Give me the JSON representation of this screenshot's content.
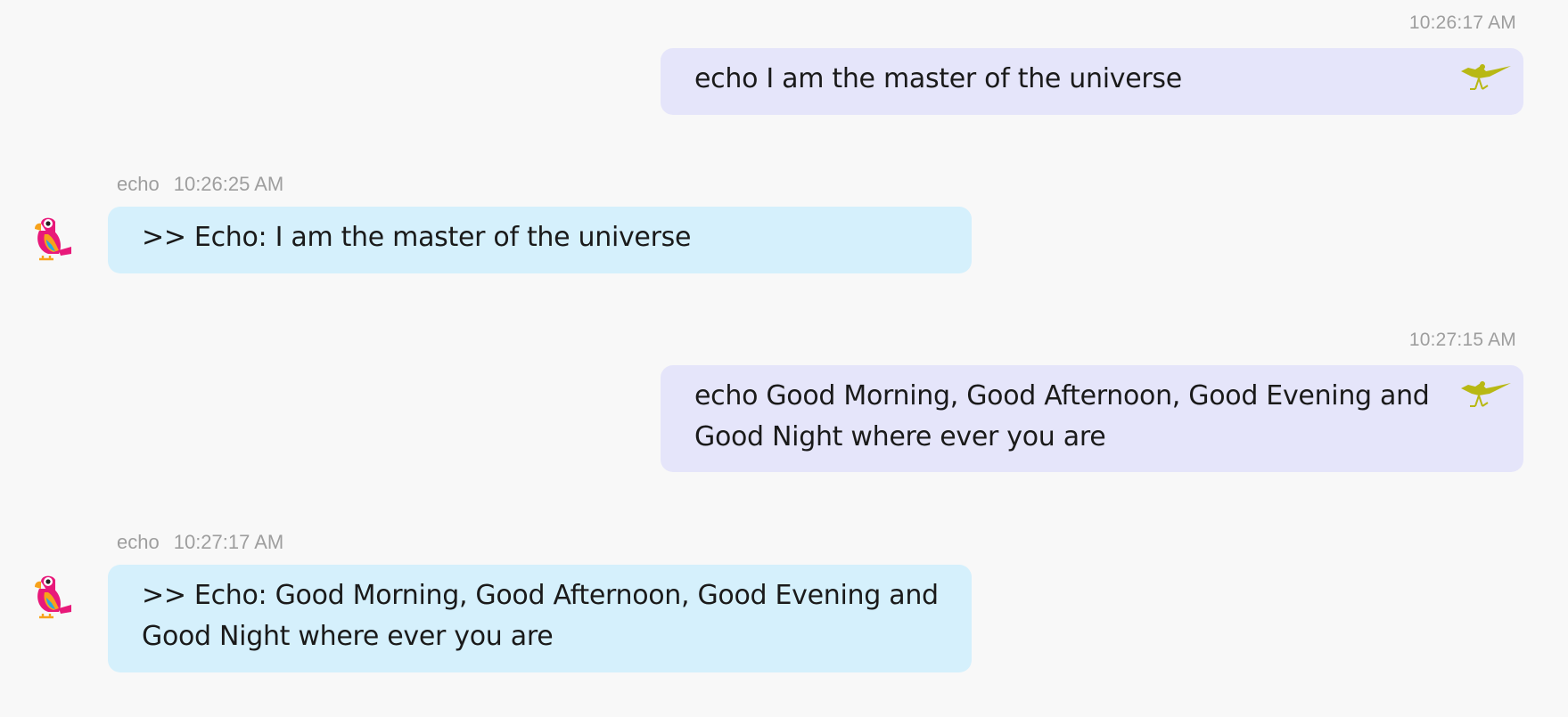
{
  "messages": [
    {
      "role": "user",
      "time": "10:26:17 AM",
      "text": "echo I am the master of the universe",
      "icon": "roadrunner-icon"
    },
    {
      "role": "bot",
      "sender": "echo",
      "time": "10:26:25 AM",
      "text": ">> Echo: I am the master of the universe",
      "icon": "parrot-icon"
    },
    {
      "role": "user",
      "time": "10:27:15 AM",
      "text": "echo Good Morning, Good Afternoon, Good Evening and Good Night where ever you are",
      "icon": "roadrunner-icon"
    },
    {
      "role": "bot",
      "sender": "echo",
      "time": "10:27:17 AM",
      "text": ">> Echo: Good Morning, Good Afternoon, Good Evening and Good Night where ever you are",
      "icon": "parrot-icon"
    }
  ],
  "colors": {
    "background": "#f8f8f8",
    "user_bubble": "#e5e5fa",
    "bot_bubble": "#d5f0fc",
    "meta_text": "#9e9e9e",
    "roadrunner": "#b8b814"
  }
}
